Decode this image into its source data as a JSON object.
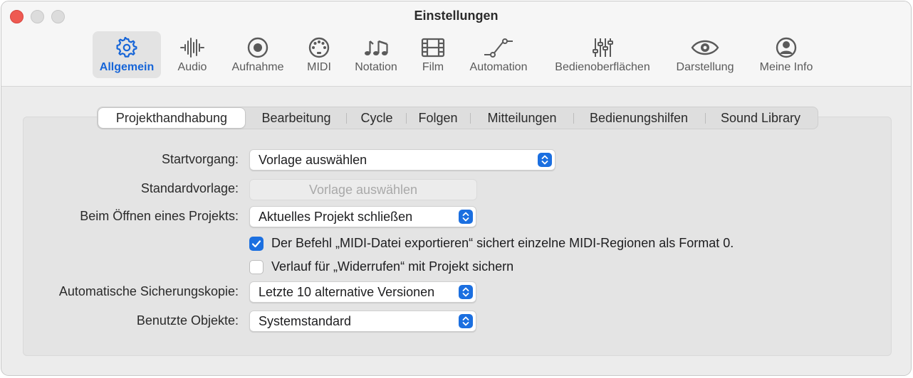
{
  "window": {
    "title": "Einstellungen"
  },
  "toolbar": {
    "items": [
      {
        "label": "Allgemein",
        "icon": "gear-icon",
        "active": true
      },
      {
        "label": "Audio",
        "icon": "waveform-icon"
      },
      {
        "label": "Aufnahme",
        "icon": "record-icon"
      },
      {
        "label": "MIDI",
        "icon": "midi-port-icon"
      },
      {
        "label": "Notation",
        "icon": "music-notes-icon"
      },
      {
        "label": "Film",
        "icon": "film-strip-icon"
      },
      {
        "label": "Automation",
        "icon": "automation-curve-icon"
      },
      {
        "label": "Bedienoberflächen",
        "icon": "sliders-icon"
      },
      {
        "label": "Darstellung",
        "icon": "eye-icon"
      },
      {
        "label": "Meine Info",
        "icon": "person-circle-icon"
      }
    ]
  },
  "tabs": {
    "items": [
      {
        "label": "Projekthandhabung",
        "active": true
      },
      {
        "label": "Bearbeitung"
      },
      {
        "label": "Cycle"
      },
      {
        "label": "Folgen"
      },
      {
        "label": "Mitteilungen"
      },
      {
        "label": "Bedienungshilfen"
      },
      {
        "label": "Sound Library"
      }
    ]
  },
  "settings": {
    "startvorgang": {
      "label": "Startvorgang:",
      "value": "Vorlage auswählen"
    },
    "standardvorlage": {
      "label": "Standardvorlage:",
      "button": "Vorlage auswählen"
    },
    "oeffnen": {
      "label": "Beim Öffnen eines Projekts:",
      "value": "Aktuelles Projekt schließen"
    },
    "midi_export": {
      "label": "Der Befehl „MIDI-Datei exportieren“ sichert einzelne MIDI-Regionen als Format 0.",
      "checked": true
    },
    "undo_history": {
      "label": "Verlauf für „Widerrufen“ mit Projekt sichern",
      "checked": false
    },
    "auto_backup": {
      "label": "Automatische Sicherungskopie:",
      "value": "Letzte 10 alternative Versionen"
    },
    "used_items": {
      "label": "Benutzte Objekte:",
      "value": "Systemstandard"
    }
  },
  "colors": {
    "accent": "#1b6fe0",
    "close": "#ee5a52"
  }
}
